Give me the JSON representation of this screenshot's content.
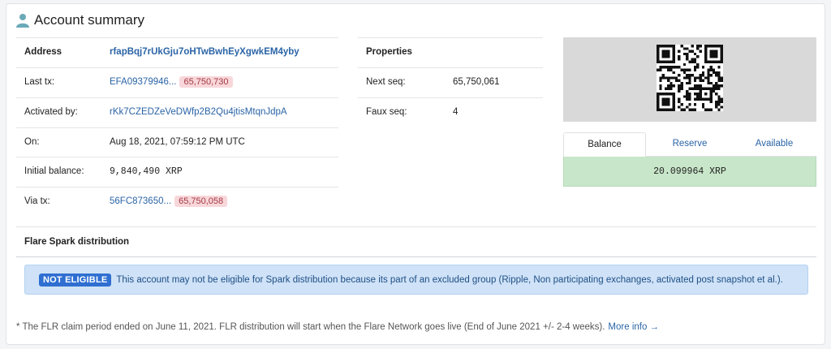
{
  "header": {
    "title": "Account summary",
    "icon": "user-icon"
  },
  "left": {
    "address_label": "Address",
    "address_value": "rfapBqj7rUkGju7oHTwBwhEyXgwkEM4yby",
    "rows": [
      {
        "label": "Last tx:",
        "value": "EFA09379946...",
        "badge": "65,750,730"
      },
      {
        "label": "Activated by:",
        "value": "rKk7CZEDZeVeDWfp2B2Qu4jtisMtqnJdpA"
      },
      {
        "label": "On:",
        "value": "Aug 18, 2021, 07:59:12 PM UTC"
      },
      {
        "label": "Initial balance:",
        "value": "9,840,490 XRP"
      },
      {
        "label": "Via tx:",
        "value": "56FC873650...",
        "badge": "65,750,058"
      }
    ]
  },
  "properties": {
    "title": "Properties",
    "next_seq_label": "Next seq:",
    "next_seq_value": "65,750,061",
    "faux_seq_label": "Faux seq:",
    "faux_seq_value": "4"
  },
  "balance": {
    "tabs": [
      "Balance",
      "Reserve",
      "Available"
    ],
    "value": "20.099964 XRP",
    "bg_color": "#c8e6c9"
  },
  "flare": {
    "title": "Flare Spark distribution",
    "badge": "NOT ELIGIBLE",
    "message": "This account may not be eligible for Spark distribution because its part of an excluded group (Ripple, Non participating exchanges, activated post snapshot et al.)."
  },
  "footer": {
    "note": "* The FLR claim period ended on June 11, 2021. FLR distribution will start when the Flare Network goes live (End of June 2021 +/- 2-4 weeks).",
    "link": "More info →"
  }
}
